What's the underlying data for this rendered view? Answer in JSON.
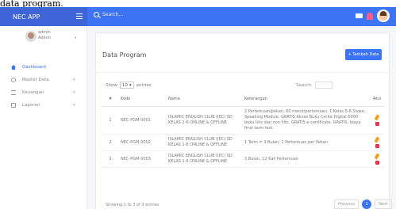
{
  "caption": "data program.",
  "app": {
    "brand": "NEC APP"
  },
  "topbar": {
    "search_placeholder": "Search..."
  },
  "sidebar": {
    "user_name": "admin",
    "user_role": "Admin",
    "items": [
      {
        "label": "Dashboard",
        "icon": "home-icon"
      },
      {
        "label": "Master Data",
        "icon": "gear-icon"
      },
      {
        "label": "Keuangan",
        "icon": "list-icon"
      },
      {
        "label": "Laporan",
        "icon": "doc-icon"
      }
    ]
  },
  "page": {
    "title": "Data Program",
    "add_button": "+ Tambah Data"
  },
  "controls": {
    "show_label": "Show",
    "show_value": "10",
    "entries_label": "entries",
    "search_label": "Search:"
  },
  "table": {
    "headers": [
      "#",
      "Kode",
      "Nama",
      "Keterangan",
      "Aksi"
    ],
    "rows": [
      {
        "num": "1",
        "kode": "NEC-PGM-0001",
        "nama": "ISLAMIC ENGLISH CLUB (IEC) SD KELAS 1-6 ONLINE & OFFLINE",
        "ket": "2 Pertemuan/pekan, 60 menit/pertemuan, 1 Kelas 5-8 Siswa, Speaking Module, GRATIS Akses Buku Cerita Digital 6000 buku hits dan non hits, GRATIS e-certificate, GRATIS, biaya final term test."
      },
      {
        "num": "2",
        "kode": "NEC-PGM-0002",
        "nama": "ISLAMIC ENGLISH CLUB (IEC) SD KELAS 1-6 ONLINE & OFFLINE",
        "ket": "1 Term = 3 Bulan, 1 Pertemuan per Pekan"
      },
      {
        "num": "3",
        "kode": "NEC-PGM-0003",
        "nama": "ISLAMIC ENGLISH CLUB (IEC) SD KELAS 1-6 ONLINE & OFFLINE",
        "ket": "3 Bulan, 12 Kali Pertemuan"
      }
    ]
  },
  "footer": {
    "showing": "Showing 1 to 3 of 3 entries",
    "prev": "Previous",
    "page": "1",
    "next": "Next"
  }
}
